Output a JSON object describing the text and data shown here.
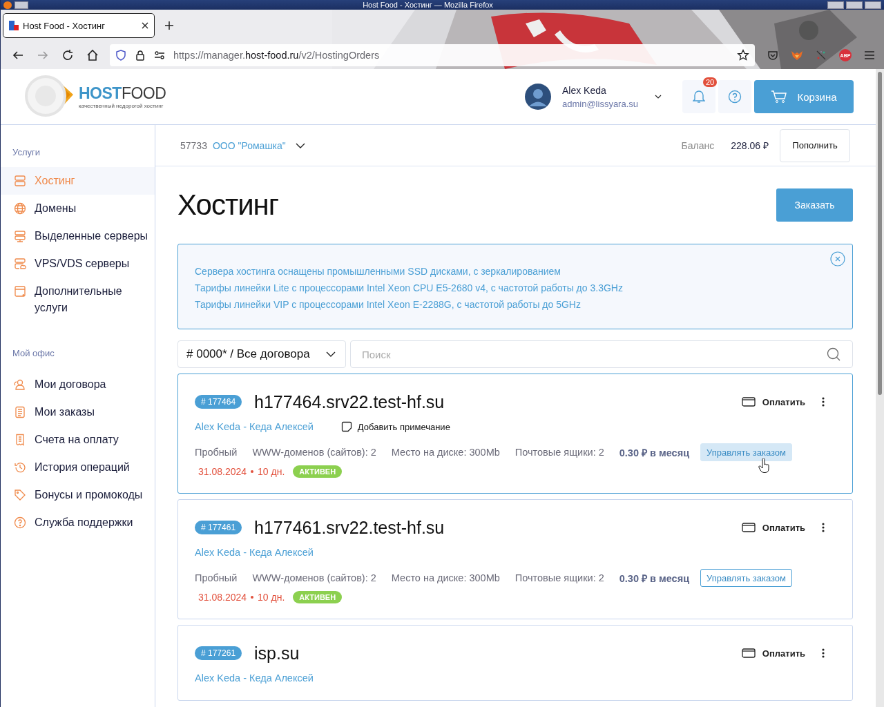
{
  "window": {
    "title": "Host Food - Хостинг — Mozilla Firefox"
  },
  "tabs": [
    {
      "label": "Host Food - Хостинг",
      "selected": true
    }
  ],
  "nav_buttons": [
    {
      "kind": "back",
      "disabled": false
    },
    {
      "kind": "forward",
      "disabled": true
    },
    {
      "kind": "reload",
      "disabled": false
    },
    {
      "kind": "home",
      "disabled": false
    }
  ],
  "address": {
    "prefix": "https://manager.",
    "domain": "host-food.ru",
    "path": "/v2/HostingOrders"
  },
  "extensions": [
    {
      "kind": "pocket"
    },
    {
      "kind": "fox"
    },
    {
      "kind": "dots"
    },
    {
      "kind": "abp",
      "label": "ABP"
    }
  ],
  "logo": {
    "part1": "HOST",
    "part2": "FOOD",
    "tagline": "качественный недорогой хостинг"
  },
  "user": {
    "name": "Alex Keda",
    "email": "admin@lissyara.su"
  },
  "notifications": {
    "count": "20"
  },
  "cart_button": "Корзина",
  "contract": {
    "number": "57733",
    "name": "ООО \"Ромашка\""
  },
  "balance": {
    "label": "Баланс",
    "amount": "228.06 ₽",
    "button": "Пополнить"
  },
  "sidebar": {
    "sections": [
      {
        "title": "Услуги",
        "items": [
          {
            "label": "Хостинг",
            "selected": true
          },
          {
            "label": "Домены",
            "selected": false
          },
          {
            "label": "Выделенные серверы",
            "selected": false
          },
          {
            "label": "VPS/VDS серверы",
            "selected": false
          },
          {
            "label": "Дополнительные услуги",
            "selected": false
          }
        ]
      },
      {
        "title": "Мой офис",
        "items": [
          {
            "label": "Мои договора",
            "selected": false
          },
          {
            "label": "Мои заказы",
            "selected": false
          },
          {
            "label": "Счета на оплату",
            "selected": false
          },
          {
            "label": "История операций",
            "selected": false
          },
          {
            "label": "Бонусы и промокоды",
            "selected": false
          },
          {
            "label": "Служба поддержки",
            "selected": false
          }
        ]
      }
    ]
  },
  "page_title": "Хостинг",
  "order_button": "Заказать",
  "info": [
    "Сервера хостинга оснащены промышленными SSD дисками, с зеркалированием",
    "Тарифы линейки Lite с процессорами Intel Xeon CPU E5-2680 v4, с частотой работы до 3.3GHz",
    "Тарифы линейки VIP с процессорами Intel Xeon E-2288G, с частотой работы до 5GHz"
  ],
  "filter": {
    "value": "# 0000* / Все договора"
  },
  "search": {
    "placeholder": "Поиск"
  },
  "orders": [
    {
      "id": "# 177464",
      "domain": "h177464.srv22.test-hf.su",
      "pay": "Оплатить",
      "owner": "Alex Keda - Кеда Алексей",
      "note": "Добавить примечание",
      "details": {
        "tariff": "Пробный",
        "sites": "WWW-доменов (сайтов): 2",
        "disk": "Место на диске: 300Mb",
        "mail": "Почтовые ящики: 2",
        "price": "0.30 ₽ в месяц",
        "manage": "Управлять заказом",
        "hovered": true,
        "date": "31.08.2024",
        "days": "10 дн.",
        "status": "АКТИВЕН"
      }
    },
    {
      "id": "# 177461",
      "domain": "h177461.srv22.test-hf.su",
      "pay": "Оплатить",
      "owner": "Alex Keda - Кеда Алексей",
      "details": {
        "tariff": "Пробный",
        "sites": "WWW-доменов (сайтов): 2",
        "disk": "Место на диске: 300Mb",
        "mail": "Почтовые ящики: 2",
        "price": "0.30 ₽ в месяц",
        "manage": "Управлять заказом",
        "hovered": false,
        "date": "31.08.2024",
        "days": "10 дн.",
        "status": "АКТИВЕН"
      }
    },
    {
      "id": "# 177261",
      "domain": "isp.su",
      "pay": "Оплатить",
      "owner": "Alex Keda - Кеда Алексей"
    }
  ]
}
